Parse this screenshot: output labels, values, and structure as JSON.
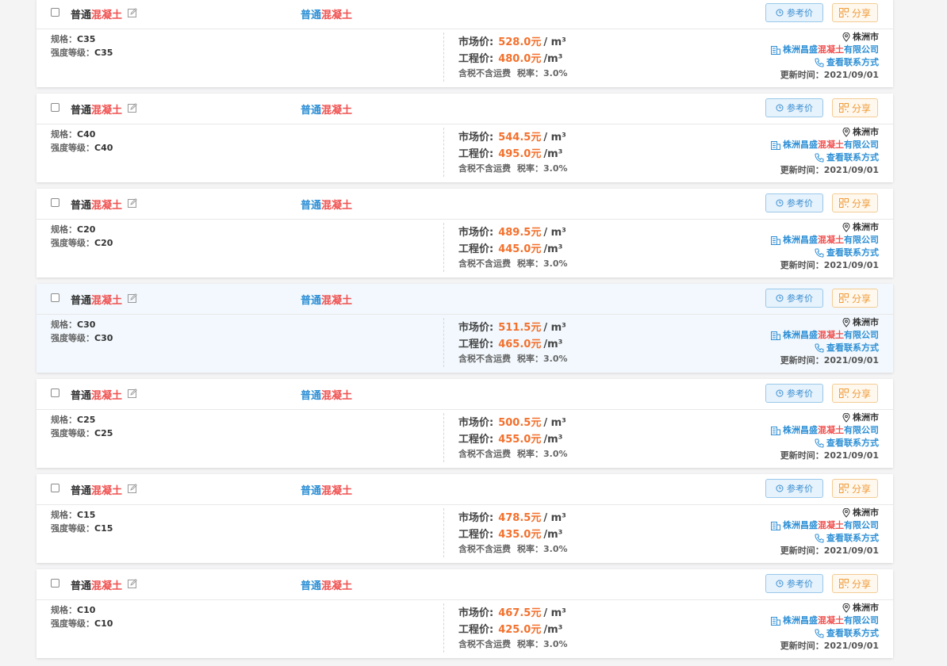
{
  "labels": {
    "spec": "规格：",
    "grade": "强度等级：",
    "market_price": "市场价:",
    "project_price": "工程价:",
    "unit_market": "/ m³",
    "unit_project": "/m³",
    "tax_note": "含税不含运费",
    "tax_rate_label": "税率：",
    "ref_button": "参考价",
    "share_button": "分享",
    "contact": "查看联系方式",
    "updated_label": "更新时间：",
    "title_prefix": "普通",
    "title_keyword": "混凝土",
    "company_prefix": "株洲昌盛",
    "company_keyword": "混凝土",
    "company_suffix": "有限公司",
    "city": "株洲市"
  },
  "items": [
    {
      "spec": "C35",
      "grade": "C35",
      "market": "528.0元",
      "project": "480.0元",
      "tax_rate": "3.0%",
      "updated": "2021/09/01",
      "highlight": false
    },
    {
      "spec": "C40",
      "grade": "C40",
      "market": "544.5元",
      "project": "495.0元",
      "tax_rate": "3.0%",
      "updated": "2021/09/01",
      "highlight": false
    },
    {
      "spec": "C20",
      "grade": "C20",
      "market": "489.5元",
      "project": "445.0元",
      "tax_rate": "3.0%",
      "updated": "2021/09/01",
      "highlight": false
    },
    {
      "spec": "C30",
      "grade": "C30",
      "market": "511.5元",
      "project": "465.0元",
      "tax_rate": "3.0%",
      "updated": "2021/09/01",
      "highlight": true
    },
    {
      "spec": "C25",
      "grade": "C25",
      "market": "500.5元",
      "project": "455.0元",
      "tax_rate": "3.0%",
      "updated": "2021/09/01",
      "highlight": false
    },
    {
      "spec": "C15",
      "grade": "C15",
      "market": "478.5元",
      "project": "435.0元",
      "tax_rate": "3.0%",
      "updated": "2021/09/01",
      "highlight": false
    },
    {
      "spec": "C10",
      "grade": "C10",
      "market": "467.5元",
      "project": "425.0元",
      "tax_rate": "3.0%",
      "updated": "2021/09/01",
      "highlight": false
    }
  ],
  "colors": {
    "keyword": "#f0504f",
    "link": "#2d8fd5",
    "price": "#f3702c",
    "share": "#ef9a36",
    "highlight_bg": "#f2f8fd"
  },
  "icons": [
    "edit-icon",
    "clock-icon",
    "share-grid-icon",
    "location-pin-icon",
    "building-icon",
    "phone-icon"
  ]
}
